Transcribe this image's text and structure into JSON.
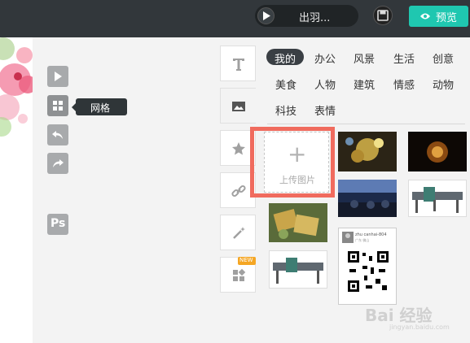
{
  "topbar": {
    "music_title": "出羽...",
    "preview_label": "预览",
    "accent_color": "#1fc7b0"
  },
  "tools": {
    "tooltip_label": "网格",
    "ps_label": "Ps",
    "icons": [
      "play-icon",
      "grid-icon",
      "undo-icon",
      "redo-icon"
    ]
  },
  "tabs": {
    "new_badge": "NEW",
    "icons": [
      "text-icon",
      "image-icon",
      "star-icon",
      "link-icon",
      "magic-wand-icon",
      "widget-icon"
    ]
  },
  "categories": {
    "row1": [
      "我的",
      "办公",
      "风景",
      "生活",
      "创意"
    ],
    "row2": [
      "美食",
      "人物",
      "建筑",
      "情感",
      "动物"
    ],
    "row3": [
      "科技",
      "表情"
    ],
    "active": "我的"
  },
  "upload": {
    "plus": "+",
    "label": "上传图片",
    "highlight_color": "#f06b5e"
  },
  "qr_card": {
    "header": "zhu canhai-804",
    "sub": "广东 佛山"
  },
  "watermark": {
    "text": "Bai 经验",
    "sub": "jingyan.baidu.com"
  }
}
